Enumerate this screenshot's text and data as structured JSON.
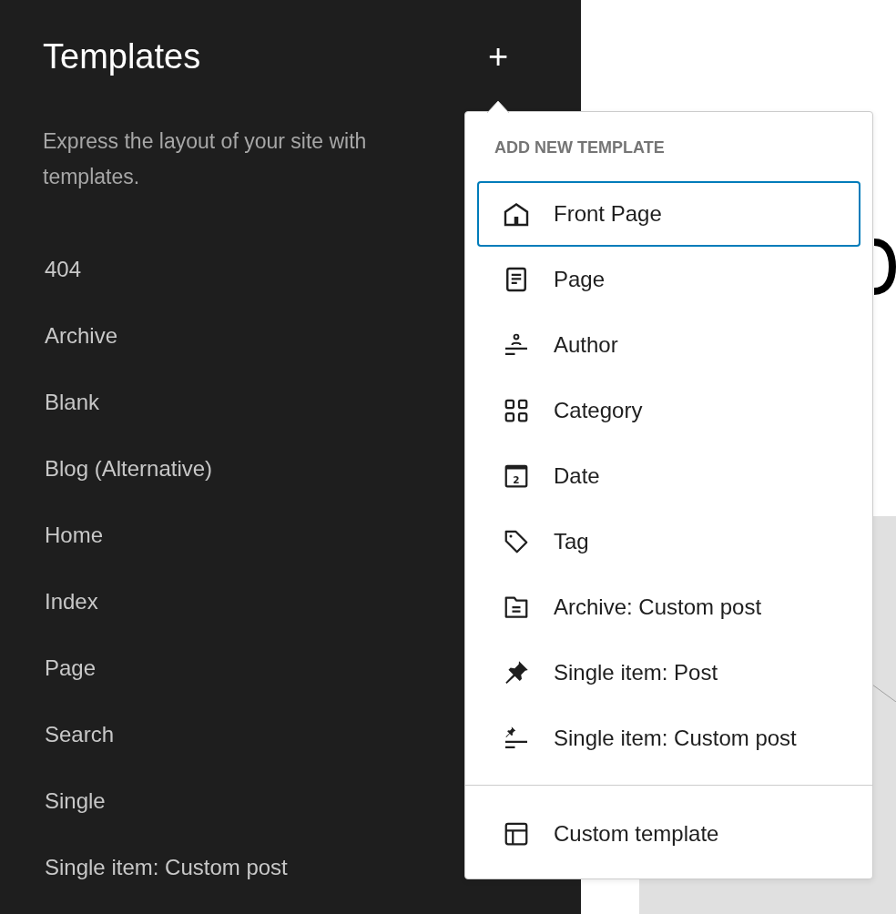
{
  "sidebar": {
    "title": "Templates",
    "add_button": "+",
    "description": "Express the layout of your site with templates.",
    "items": [
      {
        "label": "404"
      },
      {
        "label": "Archive"
      },
      {
        "label": "Blank"
      },
      {
        "label": "Blog (Alternative)"
      },
      {
        "label": "Home"
      },
      {
        "label": "Index"
      },
      {
        "label": "Page"
      },
      {
        "label": "Search"
      },
      {
        "label": "Single"
      },
      {
        "label": "Single item: Custom post"
      }
    ]
  },
  "menu": {
    "heading": "ADD NEW TEMPLATE",
    "items": [
      {
        "kind": "home",
        "label": "Front Page",
        "selected": true
      },
      {
        "kind": "page",
        "label": "Page",
        "selected": false
      },
      {
        "kind": "author",
        "label": "Author",
        "selected": false
      },
      {
        "kind": "category",
        "label": "Category",
        "selected": false
      },
      {
        "kind": "date",
        "label": "Date",
        "icon_text": "2",
        "selected": false
      },
      {
        "kind": "tag",
        "label": "Tag",
        "selected": false
      },
      {
        "kind": "archive",
        "label": "Archive: Custom post",
        "selected": false
      },
      {
        "kind": "post",
        "label": "Single item: Post",
        "selected": false
      },
      {
        "kind": "custompost",
        "label": "Single item: Custom post",
        "selected": false
      }
    ],
    "footer_item": {
      "kind": "custom",
      "label": "Custom template",
      "selected": false
    }
  }
}
